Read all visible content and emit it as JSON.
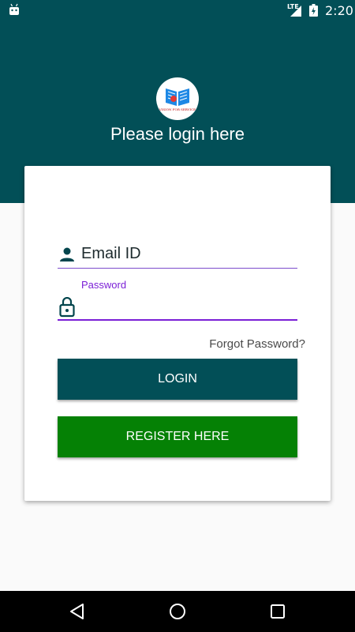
{
  "status_bar": {
    "time": "2:20",
    "network_label": "LTE",
    "icons": [
      "android-icon",
      "signal-icon",
      "battery-charging-icon"
    ]
  },
  "header": {
    "logo_caption": "VISION FOR SERVICE",
    "title": "Please login here"
  },
  "form": {
    "email_placeholder": "Email ID",
    "password_label": "Password",
    "password_value": "",
    "forgot_link": "Forgot Password?",
    "login_label": "LOGIN",
    "register_label": "REGISTER HERE"
  },
  "nav_bar": {
    "icons": [
      "back-icon",
      "home-icon",
      "recents-icon"
    ]
  },
  "colors": {
    "primary": "#024f57",
    "accent": "#7b1fd6",
    "register": "#058105",
    "background": "#fafafa"
  }
}
